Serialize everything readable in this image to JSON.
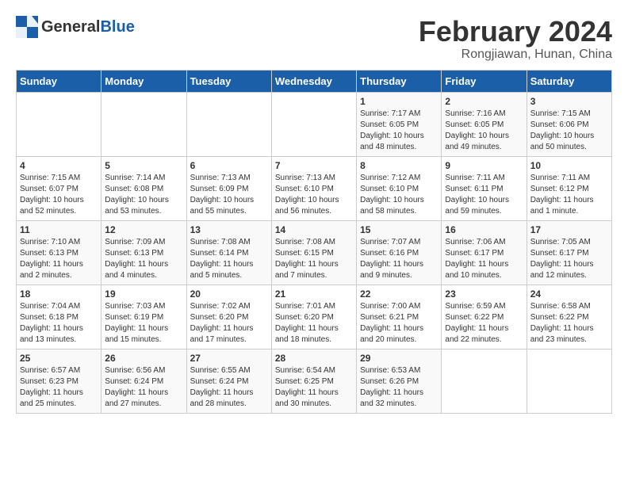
{
  "header": {
    "logo_general": "General",
    "logo_blue": "Blue",
    "month_title": "February 2024",
    "location": "Rongjiawan, Hunan, China"
  },
  "days_of_week": [
    "Sunday",
    "Monday",
    "Tuesday",
    "Wednesday",
    "Thursday",
    "Friday",
    "Saturday"
  ],
  "weeks": [
    [
      {
        "day": "",
        "info": ""
      },
      {
        "day": "",
        "info": ""
      },
      {
        "day": "",
        "info": ""
      },
      {
        "day": "",
        "info": ""
      },
      {
        "day": "1",
        "info": "Sunrise: 7:17 AM\nSunset: 6:05 PM\nDaylight: 10 hours\nand 48 minutes."
      },
      {
        "day": "2",
        "info": "Sunrise: 7:16 AM\nSunset: 6:05 PM\nDaylight: 10 hours\nand 49 minutes."
      },
      {
        "day": "3",
        "info": "Sunrise: 7:15 AM\nSunset: 6:06 PM\nDaylight: 10 hours\nand 50 minutes."
      }
    ],
    [
      {
        "day": "4",
        "info": "Sunrise: 7:15 AM\nSunset: 6:07 PM\nDaylight: 10 hours\nand 52 minutes."
      },
      {
        "day": "5",
        "info": "Sunrise: 7:14 AM\nSunset: 6:08 PM\nDaylight: 10 hours\nand 53 minutes."
      },
      {
        "day": "6",
        "info": "Sunrise: 7:13 AM\nSunset: 6:09 PM\nDaylight: 10 hours\nand 55 minutes."
      },
      {
        "day": "7",
        "info": "Sunrise: 7:13 AM\nSunset: 6:10 PM\nDaylight: 10 hours\nand 56 minutes."
      },
      {
        "day": "8",
        "info": "Sunrise: 7:12 AM\nSunset: 6:10 PM\nDaylight: 10 hours\nand 58 minutes."
      },
      {
        "day": "9",
        "info": "Sunrise: 7:11 AM\nSunset: 6:11 PM\nDaylight: 10 hours\nand 59 minutes."
      },
      {
        "day": "10",
        "info": "Sunrise: 7:11 AM\nSunset: 6:12 PM\nDaylight: 11 hours\nand 1 minute."
      }
    ],
    [
      {
        "day": "11",
        "info": "Sunrise: 7:10 AM\nSunset: 6:13 PM\nDaylight: 11 hours\nand 2 minutes."
      },
      {
        "day": "12",
        "info": "Sunrise: 7:09 AM\nSunset: 6:13 PM\nDaylight: 11 hours\nand 4 minutes."
      },
      {
        "day": "13",
        "info": "Sunrise: 7:08 AM\nSunset: 6:14 PM\nDaylight: 11 hours\nand 5 minutes."
      },
      {
        "day": "14",
        "info": "Sunrise: 7:08 AM\nSunset: 6:15 PM\nDaylight: 11 hours\nand 7 minutes."
      },
      {
        "day": "15",
        "info": "Sunrise: 7:07 AM\nSunset: 6:16 PM\nDaylight: 11 hours\nand 9 minutes."
      },
      {
        "day": "16",
        "info": "Sunrise: 7:06 AM\nSunset: 6:17 PM\nDaylight: 11 hours\nand 10 minutes."
      },
      {
        "day": "17",
        "info": "Sunrise: 7:05 AM\nSunset: 6:17 PM\nDaylight: 11 hours\nand 12 minutes."
      }
    ],
    [
      {
        "day": "18",
        "info": "Sunrise: 7:04 AM\nSunset: 6:18 PM\nDaylight: 11 hours\nand 13 minutes."
      },
      {
        "day": "19",
        "info": "Sunrise: 7:03 AM\nSunset: 6:19 PM\nDaylight: 11 hours\nand 15 minutes."
      },
      {
        "day": "20",
        "info": "Sunrise: 7:02 AM\nSunset: 6:20 PM\nDaylight: 11 hours\nand 17 minutes."
      },
      {
        "day": "21",
        "info": "Sunrise: 7:01 AM\nSunset: 6:20 PM\nDaylight: 11 hours\nand 18 minutes."
      },
      {
        "day": "22",
        "info": "Sunrise: 7:00 AM\nSunset: 6:21 PM\nDaylight: 11 hours\nand 20 minutes."
      },
      {
        "day": "23",
        "info": "Sunrise: 6:59 AM\nSunset: 6:22 PM\nDaylight: 11 hours\nand 22 minutes."
      },
      {
        "day": "24",
        "info": "Sunrise: 6:58 AM\nSunset: 6:22 PM\nDaylight: 11 hours\nand 23 minutes."
      }
    ],
    [
      {
        "day": "25",
        "info": "Sunrise: 6:57 AM\nSunset: 6:23 PM\nDaylight: 11 hours\nand 25 minutes."
      },
      {
        "day": "26",
        "info": "Sunrise: 6:56 AM\nSunset: 6:24 PM\nDaylight: 11 hours\nand 27 minutes."
      },
      {
        "day": "27",
        "info": "Sunrise: 6:55 AM\nSunset: 6:24 PM\nDaylight: 11 hours\nand 28 minutes."
      },
      {
        "day": "28",
        "info": "Sunrise: 6:54 AM\nSunset: 6:25 PM\nDaylight: 11 hours\nand 30 minutes."
      },
      {
        "day": "29",
        "info": "Sunrise: 6:53 AM\nSunset: 6:26 PM\nDaylight: 11 hours\nand 32 minutes."
      },
      {
        "day": "",
        "info": ""
      },
      {
        "day": "",
        "info": ""
      }
    ]
  ]
}
